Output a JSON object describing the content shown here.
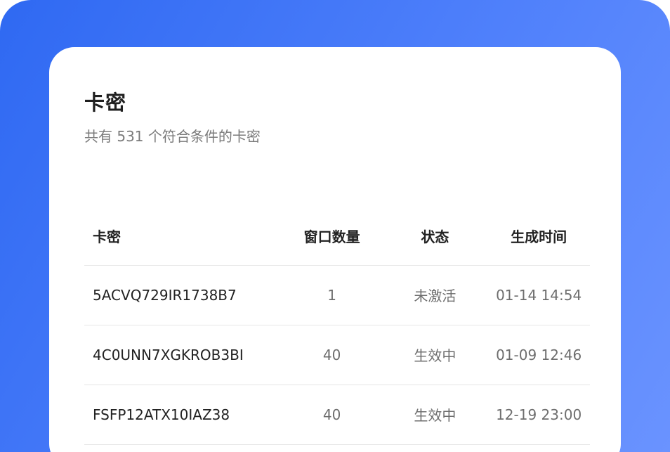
{
  "card": {
    "title": "卡密",
    "subtitle": "共有 531 个符合条件的卡密"
  },
  "table": {
    "headers": {
      "key": "卡密",
      "windows": "窗口数量",
      "status": "状态",
      "created": "生成时间"
    },
    "rows": [
      {
        "key": "5ACVQ729IR1738B7",
        "windows": "1",
        "status": "未激活",
        "created": "01-14 14:54"
      },
      {
        "key": "4C0UNN7XGKROB3BI",
        "windows": "40",
        "status": "生效中",
        "created": "01-09 12:46"
      },
      {
        "key": "FSFP12ATX10IAZ38",
        "windows": "40",
        "status": "生效中",
        "created": "12-19 23:00"
      }
    ]
  },
  "colors": {
    "background_gradient_start": "#2f69f2",
    "background_gradient_end": "#6a93ff",
    "card": "#ffffff"
  }
}
